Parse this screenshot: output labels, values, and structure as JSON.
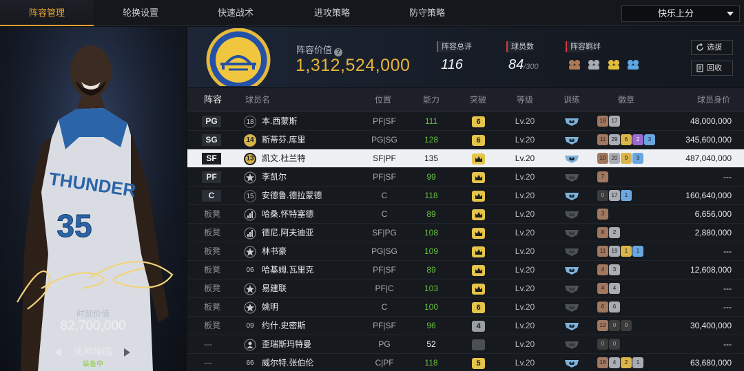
{
  "nav": {
    "tabs": [
      "阵容管理",
      "轮换设置",
      "快速战术",
      "进攻策略",
      "防守策略"
    ],
    "active_index": 0,
    "mode": "快乐上分"
  },
  "player_panel": {
    "moment_label": "时刻价值",
    "moment_value": "82,700,000",
    "skill_name": "死神降临",
    "equipped": "装备中",
    "jersey": "35",
    "team_text": "THUNDER"
  },
  "summary": {
    "lineup_value_label": "阵容价值",
    "lineup_value": "1,312,524,000",
    "overall_label": "阵容总评",
    "overall_value": "116",
    "players_label": "球员数",
    "players_value": "84",
    "players_max": "/300",
    "chemistry_label": "阵容羁绊",
    "chemistry_icons": [
      "bronze-fist-icon",
      "silver-fist-icon",
      "gold-fist-icon",
      "blue-fist-icon"
    ],
    "btn_draft": "选拔",
    "btn_recycle": "回收"
  },
  "table": {
    "headers": {
      "lineup": "阵容",
      "name": "球员名",
      "position": "位置",
      "ability": "能力",
      "breakthrough": "突破",
      "level": "等级",
      "training": "训练",
      "badges": "徽章",
      "value": "球员身价"
    },
    "rows": [
      {
        "slot": "PG",
        "jersey": "18",
        "jersey_type": "ring",
        "name": "本.西蒙斯",
        "position": "PF|SF",
        "ability": "111",
        "ability_color": "green",
        "break": "6",
        "break_type": "gold",
        "level": "Lv.20",
        "train": "lit",
        "badges": [
          [
            "b",
            "18"
          ],
          [
            "s",
            "17"
          ]
        ],
        "price": "48,000,000"
      },
      {
        "slot": "SG",
        "jersey": "14",
        "jersey_type": "gold",
        "name": "斯蒂芬.库里",
        "position": "PG|SG",
        "ability": "128",
        "ability_color": "green",
        "break": "6",
        "break_type": "gold",
        "level": "Lv.20",
        "train": "lit",
        "badges": [
          [
            "b",
            "11"
          ],
          [
            "s",
            "29"
          ],
          [
            "g",
            "6"
          ],
          [
            "p",
            "2"
          ],
          [
            "d",
            "3"
          ]
        ],
        "price": "345,600,000"
      },
      {
        "slot": "SF",
        "jersey": "13",
        "jersey_type": "gold",
        "name": "凯文.杜兰特",
        "position": "SF|PF",
        "ability": "135",
        "ability_color": "white",
        "break": "",
        "break_type": "crown",
        "level": "Lv.20",
        "train": "lit",
        "badges": [
          [
            "b",
            "10"
          ],
          [
            "s",
            "20"
          ],
          [
            "g",
            "9"
          ],
          [
            "d",
            "3"
          ]
        ],
        "price": "487,040,000",
        "selected": true
      },
      {
        "slot": "PF",
        "jersey": "",
        "jersey_type": "star",
        "name": "李凯尔",
        "position": "PF|SF",
        "ability": "99",
        "ability_color": "green",
        "break": "",
        "break_type": "crown",
        "level": "Lv.20",
        "train": "dim",
        "badges": [
          [
            "b",
            "7"
          ]
        ],
        "price": "---"
      },
      {
        "slot": "C",
        "jersey": "15",
        "jersey_type": "ring",
        "name": "安德鲁.德拉蒙德",
        "position": "C",
        "ability": "118",
        "ability_color": "green",
        "break": "",
        "break_type": "crown",
        "level": "Lv.20",
        "train": "lit",
        "badges": [
          [
            "k",
            "0"
          ],
          [
            "s",
            "17"
          ],
          [
            "d",
            "1"
          ]
        ],
        "price": "160,640,000"
      },
      {
        "slot": "板凳",
        "jersey": "",
        "jersey_type": "bars",
        "name": "哈桑.怀特塞德",
        "position": "C",
        "ability": "89",
        "ability_color": "green",
        "break": "",
        "break_type": "crown",
        "level": "Lv.20",
        "train": "dim",
        "badges": [
          [
            "b",
            "3"
          ]
        ],
        "price": "6,656,000"
      },
      {
        "slot": "板凳",
        "jersey": "",
        "jersey_type": "bars",
        "name": "德尼.阿夫迪亚",
        "position": "SF|PG",
        "ability": "108",
        "ability_color": "green",
        "break": "",
        "break_type": "crown",
        "level": "Lv.20",
        "train": "dim",
        "badges": [
          [
            "b",
            "8"
          ],
          [
            "s",
            "2"
          ]
        ],
        "price": "2,880,000"
      },
      {
        "slot": "板凳",
        "jersey": "",
        "jersey_type": "star",
        "name": "林书豪",
        "position": "PG|SG",
        "ability": "109",
        "ability_color": "green",
        "break": "",
        "break_type": "crown",
        "level": "Lv.20",
        "train": "dim",
        "badges": [
          [
            "b",
            "11"
          ],
          [
            "s",
            "19"
          ],
          [
            "g",
            "1"
          ],
          [
            "d",
            "1"
          ]
        ],
        "price": "---"
      },
      {
        "slot": "板凳",
        "jersey": "06",
        "jersey_type": "plain",
        "name": "哈基姆.瓦里克",
        "position": "PF|SF",
        "ability": "89",
        "ability_color": "green",
        "break": "",
        "break_type": "crown",
        "level": "Lv.20",
        "train": "lit",
        "badges": [
          [
            "b",
            "4"
          ],
          [
            "s",
            "3"
          ]
        ],
        "price": "12,608,000"
      },
      {
        "slot": "板凳",
        "jersey": "",
        "jersey_type": "star",
        "name": "易建联",
        "position": "PF|C",
        "ability": "103",
        "ability_color": "green",
        "break": "",
        "break_type": "crown",
        "level": "Lv.20",
        "train": "dim",
        "badges": [
          [
            "b",
            "4"
          ],
          [
            "s",
            "4"
          ]
        ],
        "price": "---"
      },
      {
        "slot": "板凳",
        "jersey": "",
        "jersey_type": "star",
        "name": "姚明",
        "position": "C",
        "ability": "100",
        "ability_color": "green",
        "break": "6",
        "break_type": "gold",
        "level": "Lv.20",
        "train": "dim",
        "badges": [
          [
            "b",
            "6"
          ],
          [
            "s",
            "6"
          ]
        ],
        "price": "---"
      },
      {
        "slot": "板凳",
        "jersey": "09",
        "jersey_type": "plain",
        "name": "约什.史密斯",
        "position": "PF|SF",
        "ability": "96",
        "ability_color": "green",
        "break": "4",
        "break_type": "gray",
        "level": "Lv.20",
        "train": "lit",
        "badges": [
          [
            "b",
            "12"
          ],
          [
            "k",
            "0"
          ],
          [
            "k",
            "0"
          ]
        ],
        "price": "30,400,000"
      },
      {
        "slot": "---",
        "jersey": "",
        "jersey_type": "person",
        "name": "歪瑞斯玛特曼",
        "position": "PG",
        "ability": "52",
        "ability_color": "white",
        "break": "",
        "break_type": "dark",
        "level": "Lv.20",
        "train": "dim",
        "badges": [
          [
            "k",
            "0"
          ],
          [
            "k",
            "0"
          ]
        ],
        "price": "---"
      },
      {
        "slot": "---",
        "jersey": "66",
        "jersey_type": "plain",
        "name": "威尔特.张伯伦",
        "position": "C|PF",
        "ability": "118",
        "ability_color": "green",
        "break": "5",
        "break_type": "gold",
        "level": "Lv.20",
        "train": "lit",
        "badges": [
          [
            "b",
            "16"
          ],
          [
            "s",
            "4"
          ],
          [
            "g",
            "2"
          ],
          [
            "s",
            "1"
          ]
        ],
        "price": "63,680,000"
      }
    ]
  },
  "colors": {
    "accent": "#e8a033",
    "gold_value": "#e8b43a",
    "green_ability": "#64c23c",
    "red_marker": "#d8393a"
  }
}
